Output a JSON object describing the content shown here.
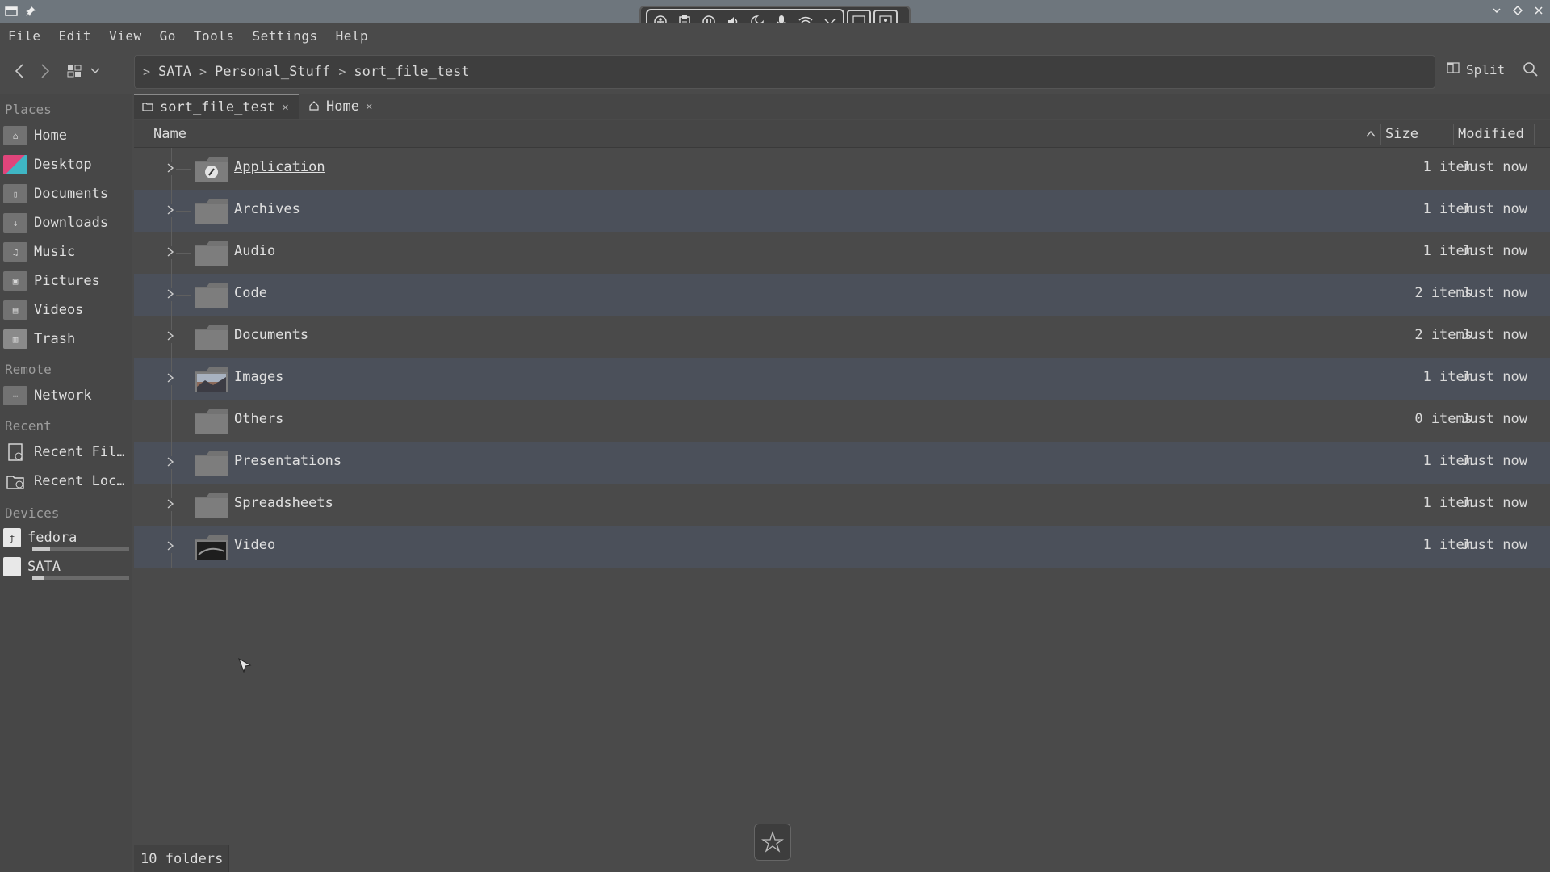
{
  "menubar": [
    "File",
    "Edit",
    "View",
    "Go",
    "Tools",
    "Settings",
    "Help"
  ],
  "toolbar": {
    "breadcrumb": [
      "SATA",
      "Personal_Stuff",
      "sort_file_test"
    ],
    "split_label": "Split"
  },
  "sidebar": {
    "sections": {
      "places": "Places",
      "remote": "Remote",
      "recent": "Recent",
      "devices": "Devices"
    },
    "places": [
      {
        "label": "Home",
        "icon": "home-icon"
      },
      {
        "label": "Desktop",
        "icon": "desktop-icon"
      },
      {
        "label": "Documents",
        "icon": "documents-folder-icon"
      },
      {
        "label": "Downloads",
        "icon": "downloads-folder-icon"
      },
      {
        "label": "Music",
        "icon": "music-folder-icon"
      },
      {
        "label": "Pictures",
        "icon": "pictures-folder-icon"
      },
      {
        "label": "Videos",
        "icon": "videos-folder-icon"
      },
      {
        "label": "Trash",
        "icon": "trash-icon"
      }
    ],
    "remote": [
      {
        "label": "Network",
        "icon": "network-folder-icon"
      }
    ],
    "recent": [
      {
        "label": "Recent Fil…",
        "icon": "recent-files-icon"
      },
      {
        "label": "Recent Loc…",
        "icon": "recent-locations-icon"
      }
    ],
    "devices": [
      {
        "label": "fedora",
        "icon": "drive-icon",
        "usage": 0.18
      },
      {
        "label": "SATA",
        "icon": "drive-icon",
        "usage": 0.12
      }
    ]
  },
  "tabs": [
    {
      "label": "sort_file_test",
      "active": true
    },
    {
      "label": "Home",
      "active": false
    }
  ],
  "columns": {
    "name": "Name",
    "size": "Size",
    "modified": "Modified"
  },
  "files": [
    {
      "name": "Application",
      "size": "1 item",
      "modified": "Just now",
      "expandable": true,
      "icon": "application-folder-icon"
    },
    {
      "name": "Archives",
      "size": "1 item",
      "modified": "Just now",
      "expandable": true,
      "icon": "folder-icon"
    },
    {
      "name": "Audio",
      "size": "1 item",
      "modified": "Just now",
      "expandable": true,
      "icon": "folder-icon"
    },
    {
      "name": "Code",
      "size": "2 items",
      "modified": "Just now",
      "expandable": true,
      "icon": "folder-icon"
    },
    {
      "name": "Documents",
      "size": "2 items",
      "modified": "Just now",
      "expandable": true,
      "icon": "folder-icon"
    },
    {
      "name": "Images",
      "size": "1 item",
      "modified": "Just now",
      "expandable": true,
      "icon": "image-thumbnail-folder-icon"
    },
    {
      "name": "Others",
      "size": "0 items",
      "modified": "Just now",
      "expandable": false,
      "icon": "folder-icon"
    },
    {
      "name": "Presentations",
      "size": "1 item",
      "modified": "Just now",
      "expandable": true,
      "icon": "folder-icon"
    },
    {
      "name": "Spreadsheets",
      "size": "1 item",
      "modified": "Just now",
      "expandable": true,
      "icon": "folder-icon"
    },
    {
      "name": "Video",
      "size": "1 item",
      "modified": "Just now",
      "expandable": true,
      "icon": "video-thumbnail-folder-icon"
    }
  ],
  "status": {
    "text": "10 folders"
  },
  "colors": {
    "row_alt": "#4b505a",
    "titlebar": "#6e767d",
    "background": "#4a4a4a"
  }
}
